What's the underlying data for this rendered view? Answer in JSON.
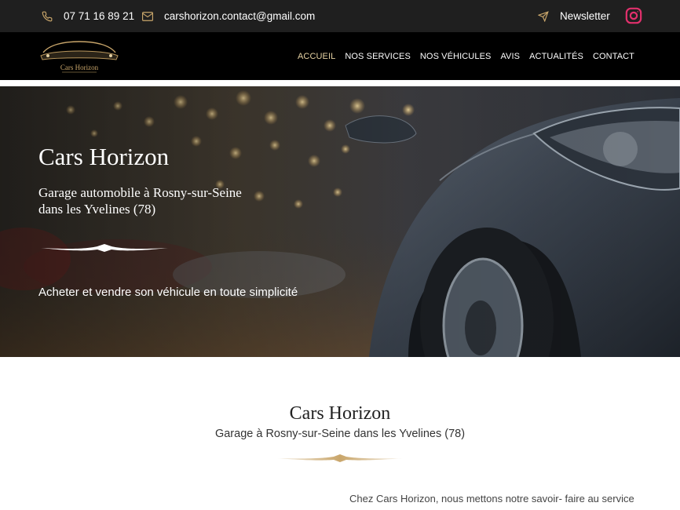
{
  "topbar": {
    "phone": "07 71 16 89 21",
    "email": "carshorizon.contact@gmail.com",
    "newsletter": "Newsletter",
    "icons": [
      "phone-icon",
      "mail-icon",
      "paper-plane-icon",
      "instagram-icon"
    ]
  },
  "nav": {
    "logo_text": "Cars Horizon",
    "items": [
      {
        "label": "ACCUEIL",
        "active": true
      },
      {
        "label": "NOS SERVICES",
        "active": false
      },
      {
        "label": "NOS VÉHICULES",
        "active": false
      },
      {
        "label": "AVIS",
        "active": false
      },
      {
        "label": "ACTUALITÉS",
        "active": false
      },
      {
        "label": "CONTACT",
        "active": false
      }
    ]
  },
  "hero": {
    "title": "Cars Horizon",
    "subtitle": "Garage automobile à Rosny-sur-Seine dans les Yvelines (78)",
    "tagline": "Acheter et vendre son véhicule en toute simplicité"
  },
  "section": {
    "title": "Cars Horizon",
    "subtitle": "Garage à Rosny-sur-Seine dans les Yvelines (78)",
    "intro": "Chez Cars Horizon, nous mettons notre savoir- faire au service"
  },
  "colors": {
    "accent_gold": "#c9a66b",
    "nav_active": "#e5d1a2",
    "instagram": "#e1306c"
  }
}
